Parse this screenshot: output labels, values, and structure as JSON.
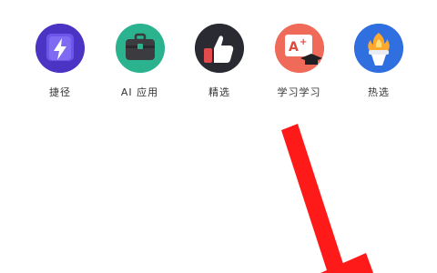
{
  "apps": [
    {
      "label": "捷径",
      "icon": "lightning-shortcut-icon",
      "color": "#5b3fd6"
    },
    {
      "label": "AI 应用",
      "icon": "briefcase-icon",
      "color": "#2bb38f"
    },
    {
      "label": "精选",
      "icon": "thumbs-up-icon",
      "color": "#2a2a33"
    },
    {
      "label": "学习学习",
      "icon": "a-plus-graduation-icon",
      "color": "#f06a5a"
    },
    {
      "label": "热选",
      "icon": "torch-flame-icon",
      "color": "#2f6fe0"
    }
  ],
  "annotation": {
    "icon": "red-arrow-annotation",
    "color": "#ff1a1a"
  }
}
